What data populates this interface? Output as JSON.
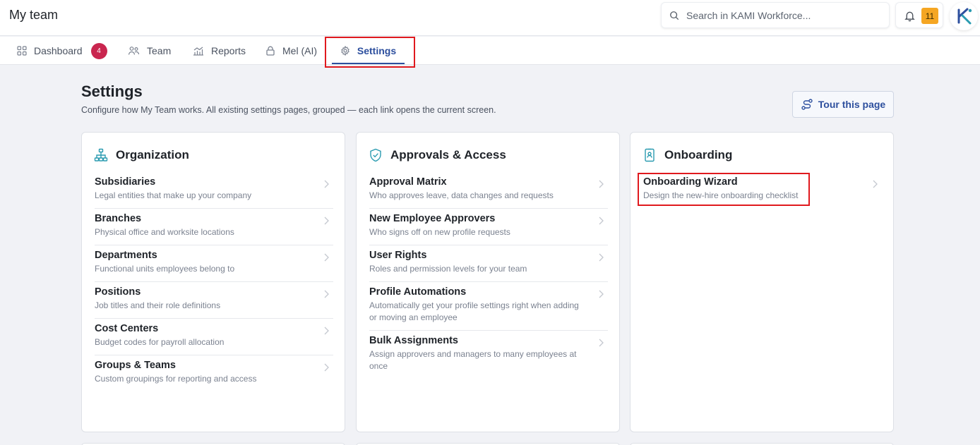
{
  "app": {
    "title": "My team",
    "search_placeholder": "Search in KAMI Workforce...",
    "notification_count": "11"
  },
  "tabs": [
    {
      "label": "Dashboard",
      "icon": "grid-icon",
      "badge": "4"
    },
    {
      "label": "Team",
      "icon": "people-icon"
    },
    {
      "label": "Reports",
      "icon": "chart-icon"
    },
    {
      "label": "Mel (AI)",
      "icon": "lock-icon"
    },
    {
      "label": "Settings",
      "icon": "gear-icon",
      "active": true
    }
  ],
  "page": {
    "title": "Settings",
    "subtitle": "Configure how My Team works. All existing settings pages, grouped — each link opens the current screen.",
    "tour_label": "Tour this page"
  },
  "cards": [
    {
      "title": "Organization",
      "icon": "org-chart-icon",
      "items": [
        {
          "name": "Subsidiaries",
          "desc": "Legal entities that make up your company"
        },
        {
          "name": "Branches",
          "desc": "Physical office and worksite locations"
        },
        {
          "name": "Departments",
          "desc": "Functional units employees belong to"
        },
        {
          "name": "Positions",
          "desc": "Job titles and their role definitions"
        },
        {
          "name": "Cost Centers",
          "desc": "Budget codes for payroll allocation"
        },
        {
          "name": "Groups & Teams",
          "desc": "Custom groupings for reporting and access"
        }
      ]
    },
    {
      "title": "Approvals & Access",
      "icon": "shield-check-icon",
      "items": [
        {
          "name": "Approval Matrix",
          "desc": "Who approves leave, data changes and requests"
        },
        {
          "name": "New Employee Approvers",
          "desc": "Who signs off on new profile requests"
        },
        {
          "name": "User Rights",
          "desc": "Roles and permission levels for your team"
        },
        {
          "name": "Profile Automations",
          "desc": "Automatically get your profile settings right when adding or moving an employee"
        },
        {
          "name": "Bulk Assignments",
          "desc": "Assign approvers and managers to many employees at once"
        }
      ]
    },
    {
      "title": "Onboarding",
      "icon": "id-badge-icon",
      "items": [
        {
          "name": "Onboarding Wizard",
          "desc": "Design the new-hire onboarding checklist"
        }
      ]
    }
  ],
  "colors": {
    "accent": "#2d4f9e",
    "badge": "#c9264f",
    "notification": "#f5a623",
    "highlight": "#e0191e",
    "icon_teal": "#2a9bb0"
  }
}
